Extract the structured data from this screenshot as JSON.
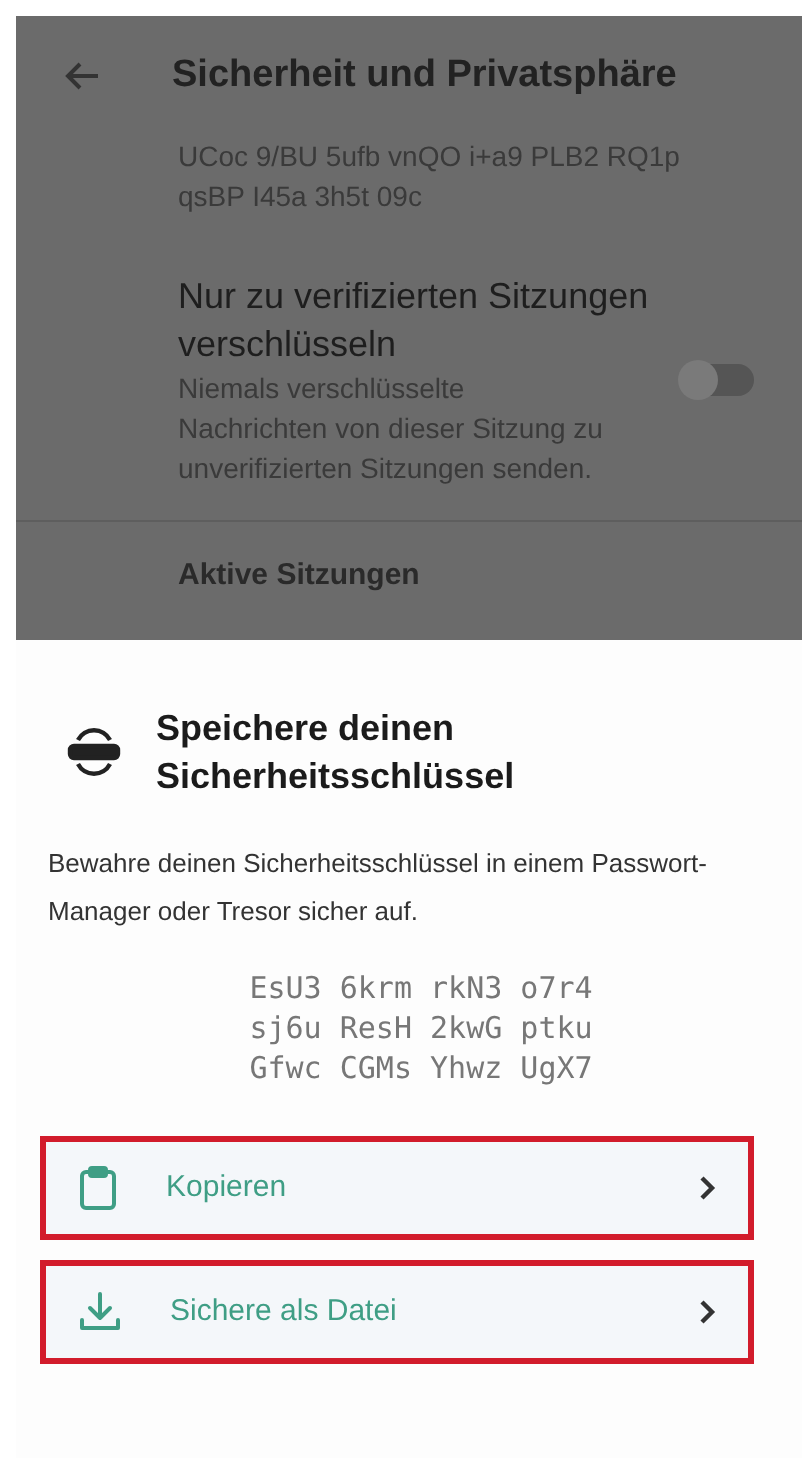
{
  "background": {
    "title": "Sicherheit und Privatsphäre",
    "key_lines": [
      "UCoc 9/BU 5ufb vnQO i+a9 PLB2 RQ1p",
      "qsBP I45a 3h5t 09c"
    ],
    "setting": {
      "title": "Nur zu verifizierten Sitzungen verschlüsseln",
      "description": "Niemals verschlüsselte Nachrichten von dieser Sitzung zu unverifizierten Sitzungen senden.",
      "on": false
    },
    "section_heading": "Aktive Sitzungen"
  },
  "sheet": {
    "title": "Speichere deinen Sicherheitsschlüssel",
    "description": "Bewahre deinen Sicherheitsschlüssel in einem Passwort-Manager oder Tresor sicher auf.",
    "key": [
      "EsU3 6krm rkN3 o7r4",
      "sj6u ResH 2kwG ptku",
      "Gfwc CGMs Yhwz UgX7"
    ],
    "actions": [
      {
        "kind": "copy",
        "label": "Kopieren",
        "highlighted": true
      },
      {
        "kind": "download",
        "label": "Sichere als Datei",
        "highlighted": true
      }
    ]
  }
}
